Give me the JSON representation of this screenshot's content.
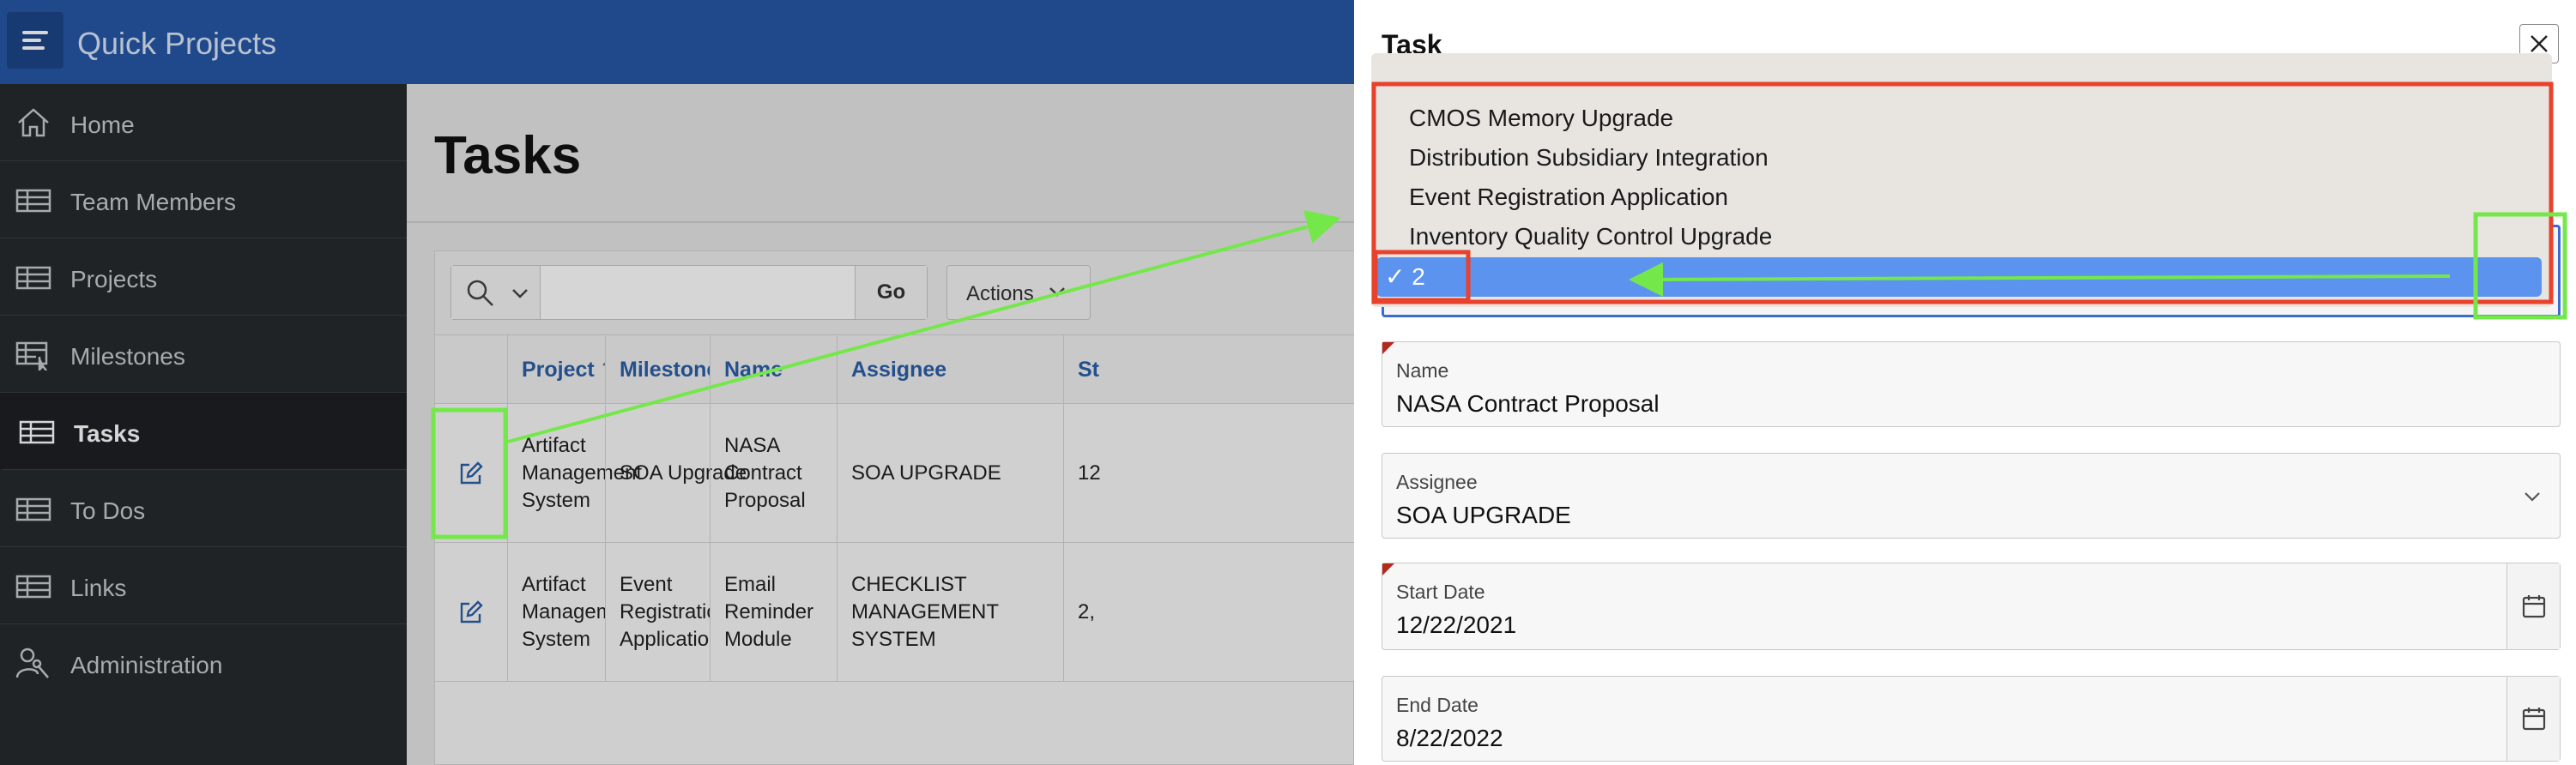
{
  "app": {
    "title": "Quick Projects"
  },
  "sidebar": {
    "items": [
      {
        "label": "Home",
        "icon": "home-icon"
      },
      {
        "label": "Team Members",
        "icon": "table-icon"
      },
      {
        "label": "Projects",
        "icon": "table-icon"
      },
      {
        "label": "Milestones",
        "icon": "table-pointer-icon"
      },
      {
        "label": "Tasks",
        "icon": "table-icon",
        "active": true
      },
      {
        "label": "To Dos",
        "icon": "table-icon"
      },
      {
        "label": "Links",
        "icon": "table-icon"
      },
      {
        "label": "Administration",
        "icon": "admin-user-wrench-icon"
      }
    ]
  },
  "main": {
    "title": "Tasks",
    "toolbar": {
      "go_label": "Go",
      "actions_label": "Actions",
      "search_value": ""
    },
    "columns": [
      "Project",
      "Milestone",
      "Name",
      "Assignee",
      "St"
    ],
    "rows": [
      {
        "project": "Artifact Management System",
        "milestone": "SOA Upgrade",
        "name": "NASA Contract Proposal",
        "assignee": "SOA UPGRADE",
        "start": "12"
      },
      {
        "project": "Artifact Management System",
        "milestone": "Event Registration Application",
        "name": "Email Reminder Module",
        "assignee": "CHECKLIST MANAGEMENT SYSTEM",
        "start": "2,"
      }
    ]
  },
  "dialog": {
    "title": "Task",
    "dropdown": {
      "options": [
        "CMOS Memory Upgrade",
        "Distribution Subsidiary Integration",
        "Event Registration Application",
        "Inventory Quality Control Upgrade"
      ],
      "selected_check": "✓",
      "selected": "2"
    },
    "fields": {
      "name": {
        "label": "Name",
        "value": "NASA Contract Proposal"
      },
      "assignee": {
        "label": "Assignee",
        "value": "SOA UPGRADE"
      },
      "start_date": {
        "label": "Start Date",
        "value": "12/22/2021"
      },
      "end_date": {
        "label": "End Date",
        "value": "8/22/2022"
      }
    }
  },
  "colors": {
    "topbar": "#2558a6",
    "sidebar": "#262a2e",
    "link": "#2c5fa8",
    "selected_option": "#5b93ef",
    "annotation_red": "#e8412c",
    "annotation_green": "#74e84a"
  }
}
